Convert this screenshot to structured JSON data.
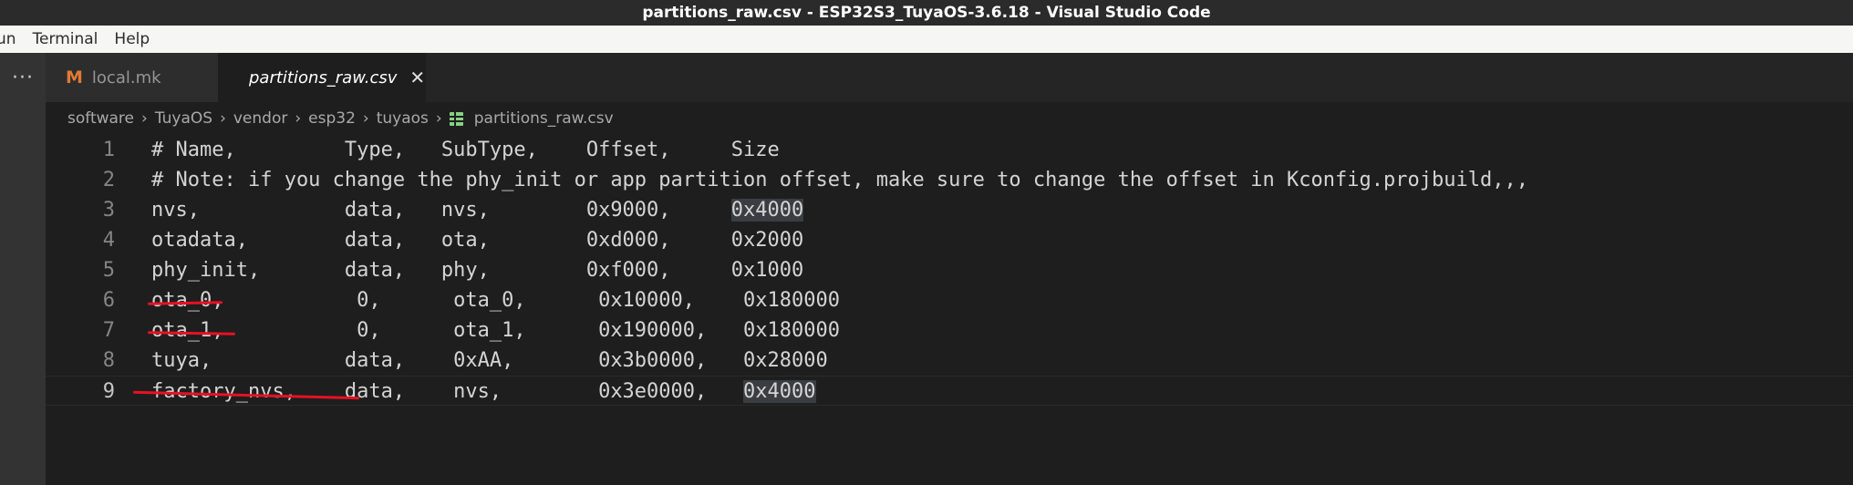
{
  "window": {
    "title": "partitions_raw.csv - ESP32S3_TuyaOS-3.6.18 - Visual Studio Code"
  },
  "menu": {
    "items": [
      "un",
      "Terminal",
      "Help"
    ]
  },
  "activity": {
    "more_label": "···"
  },
  "tabs": [
    {
      "label": "local.mk",
      "icon": "makefile-m-icon",
      "active": false
    },
    {
      "label": "partitions_raw.csv",
      "icon": "csv-table-icon",
      "active": true,
      "close": "✕"
    }
  ],
  "breadcrumb": [
    "software",
    "TuyaOS",
    "vendor",
    "esp32",
    "tuyaos",
    "partitions_raw.csv"
  ],
  "breadcrumb_sep": "›",
  "editor": {
    "lines": [
      {
        "num": "1",
        "segments": [
          {
            "text": "# Name,         Type,   SubType,    Offset,     Size",
            "hl": false
          }
        ]
      },
      {
        "num": "2",
        "segments": [
          {
            "text": "# Note: if you change the phy_init or app partition offset, make sure to change the offset in Kconfig.projbuild,,,",
            "hl": false
          }
        ]
      },
      {
        "num": "3",
        "segments": [
          {
            "text": "nvs,            data,   nvs,        0x9000,     ",
            "hl": false
          },
          {
            "text": "0x4000",
            "hl": true
          }
        ]
      },
      {
        "num": "4",
        "segments": [
          {
            "text": "otadata,        data,   ota,        0xd000,     0x2000",
            "hl": false
          }
        ]
      },
      {
        "num": "5",
        "segments": [
          {
            "text": "phy_init,       data,   phy,        0xf000,     0x1000",
            "hl": false
          }
        ]
      },
      {
        "num": "6",
        "segments": [
          {
            "text": "ota_0,           0,      ota_0,      0x10000,    0x180000",
            "hl": false
          }
        ]
      },
      {
        "num": "7",
        "segments": [
          {
            "text": "ota_1,           0,      ota_1,      0x190000,   0x180000",
            "hl": false
          }
        ]
      },
      {
        "num": "8",
        "segments": [
          {
            "text": "tuya,           data,    0xAA,       0x3b0000,   0x28000",
            "hl": false
          }
        ]
      },
      {
        "num": "9",
        "segments": [
          {
            "text": "factory_nvs,    data,    nvs,        0x3e0000,   ",
            "hl": false
          },
          {
            "text": "0x4000",
            "hl": true
          }
        ]
      }
    ],
    "current_line": "9"
  }
}
